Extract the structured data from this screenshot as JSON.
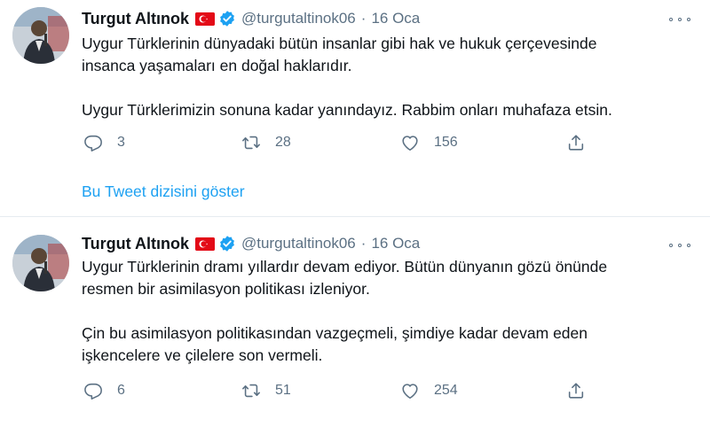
{
  "tweets": [
    {
      "author_name": "Turgut Altınok",
      "handle": "@turgutaltinok06",
      "separator": "·",
      "date": "16 Oca",
      "paragraphs": [
        "Uygur Türklerinin dünyadaki bütün insanlar gibi hak ve hukuk çerçevesinde",
        "insanca yaşamaları en doğal haklarıdır.",
        "Uygur Türklerimizin sonuna kadar yanındayız. Rabbim onları muhafaza etsin."
      ],
      "replies": "3",
      "retweets": "28",
      "likes": "156",
      "thread_link": "Bu Tweet dizisini göster"
    },
    {
      "author_name": "Turgut Altınok",
      "handle": "@turgutaltinok06",
      "separator": "·",
      "date": "16 Oca",
      "paragraphs": [
        "Uygur Türklerinin dramı yıllardır devam ediyor. Bütün dünyanın gözü önünde",
        "resmen bir asimilasyon politikası izleniyor.",
        "Çin bu asimilasyon politikasından vazgeçmeli, şimdiye kadar devam eden",
        "işkencelere ve çilelere son vermeli."
      ],
      "replies": "6",
      "retweets": "51",
      "likes": "254"
    }
  ],
  "icons": {
    "flag": "turkey-flag-icon",
    "verified": "verified-badge-icon",
    "more": "more-options-icon",
    "reply": "reply-icon",
    "retweet": "retweet-icon",
    "like": "heart-icon",
    "share": "share-icon"
  },
  "colors": {
    "link": "#1da1f2",
    "muted": "#5b7083",
    "text": "#0f1419",
    "verified": "#1da1f2",
    "flag": "#e30a17"
  }
}
